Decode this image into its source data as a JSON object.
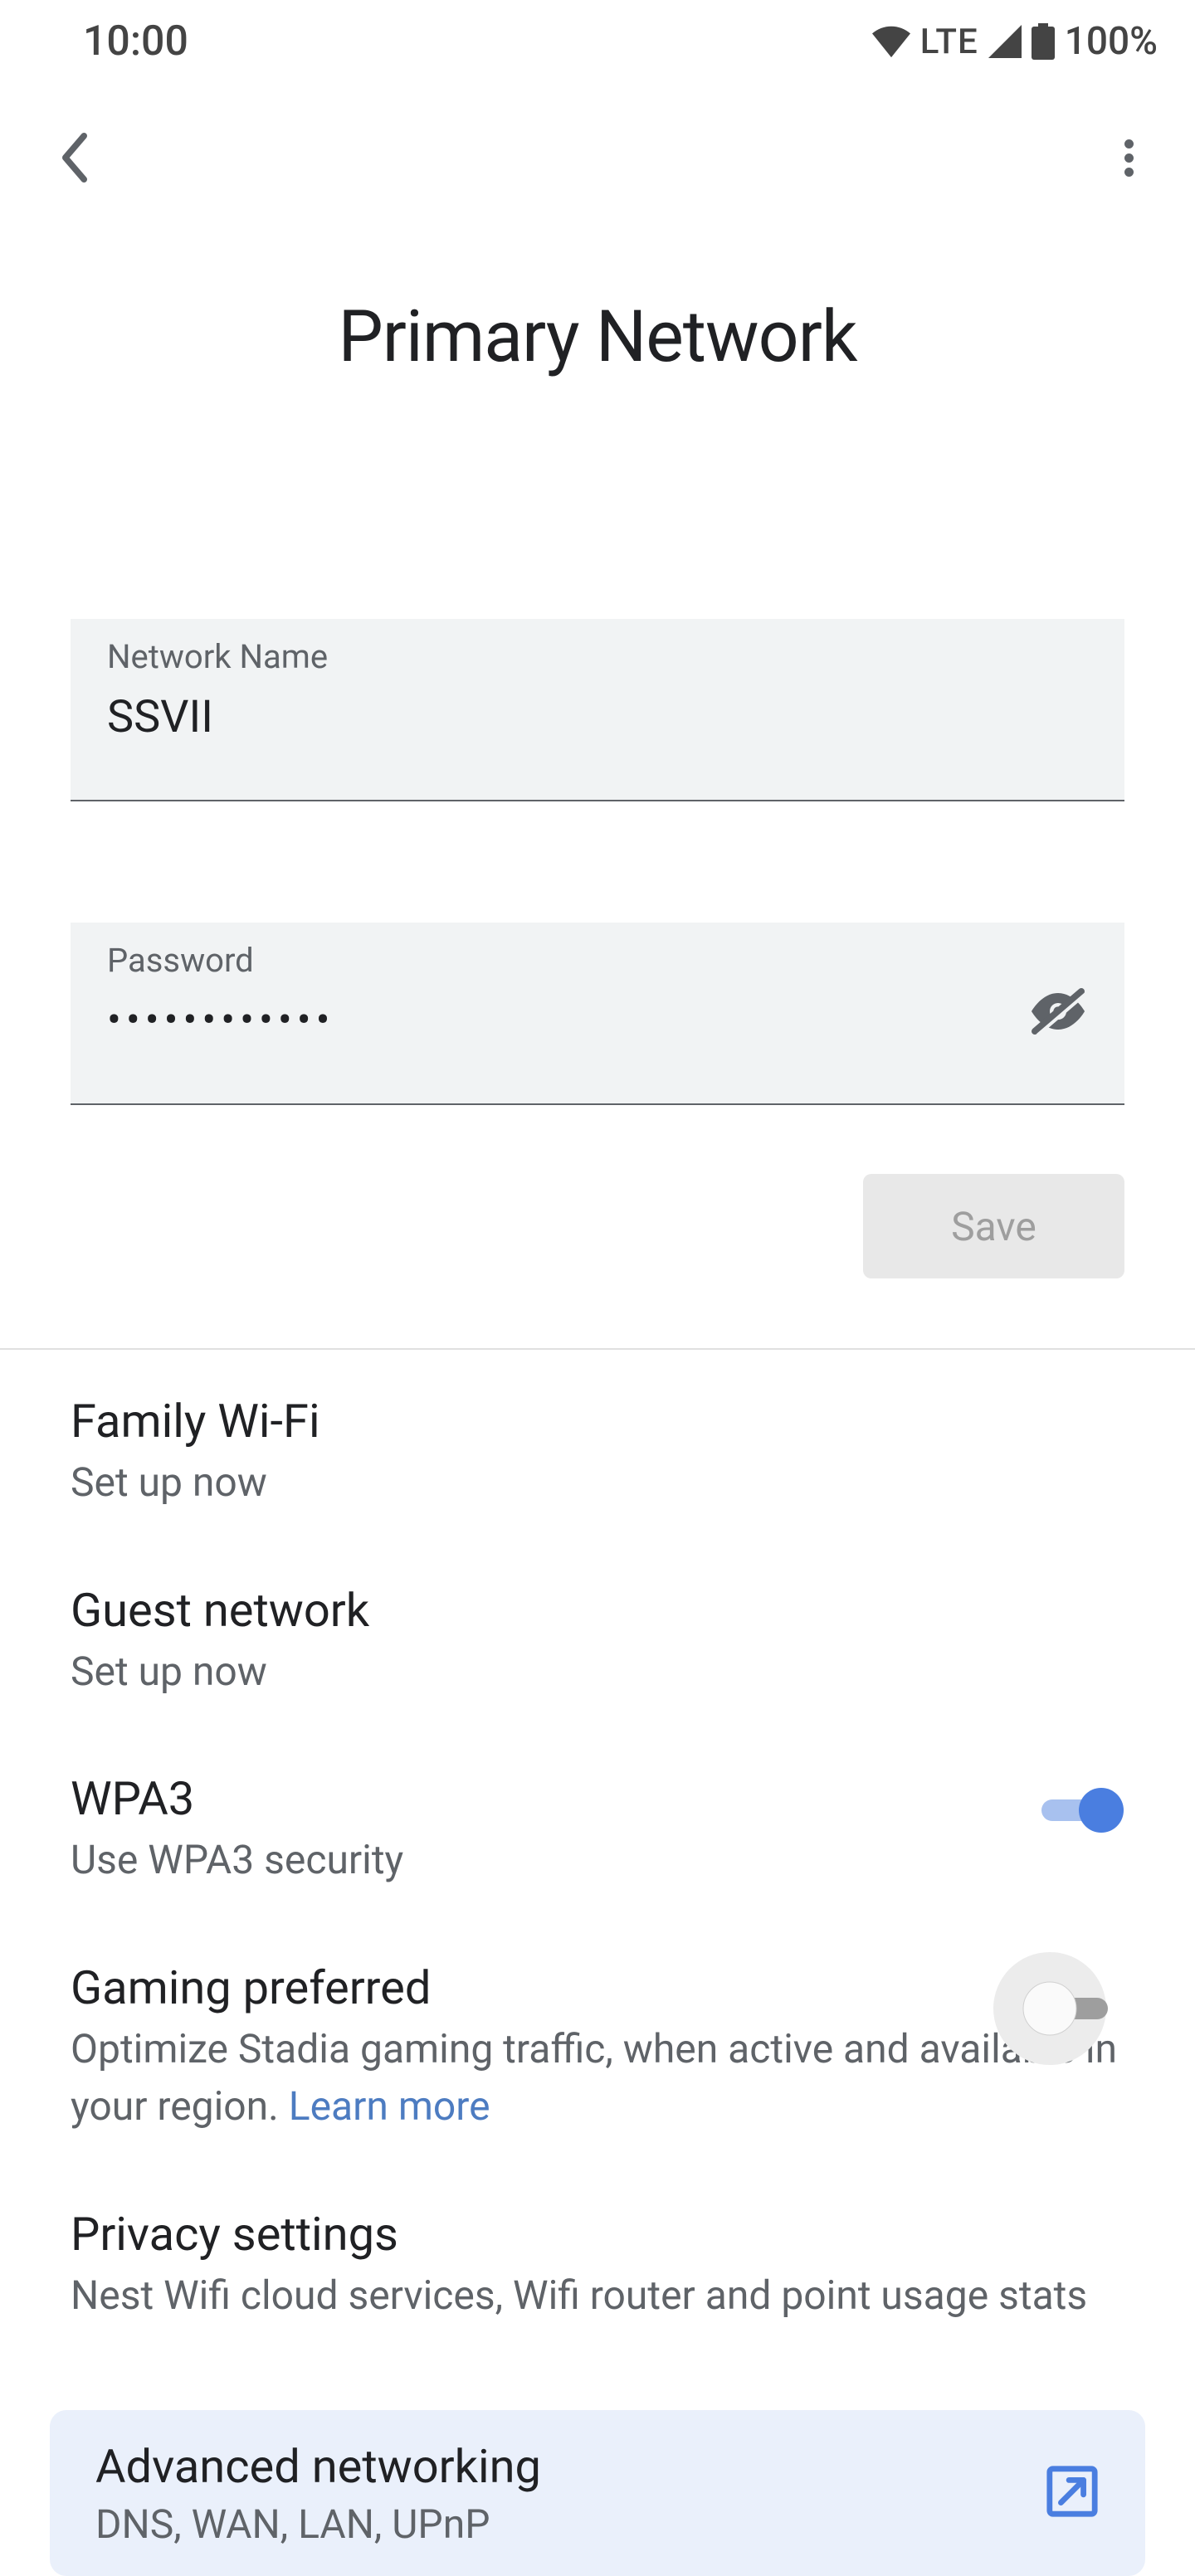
{
  "status": {
    "time": "10:00",
    "lte": "LTE",
    "battery": "100%"
  },
  "title": "Primary Network",
  "network_field": {
    "label": "Network Name",
    "value": "SSVII"
  },
  "password_field": {
    "label": "Password",
    "value": "••••••••••••"
  },
  "save_label": "Save",
  "items": {
    "family": {
      "title": "Family Wi-Fi",
      "sub": "Set up now"
    },
    "guest": {
      "title": "Guest network",
      "sub": "Set up now"
    },
    "wpa3": {
      "title": "WPA3",
      "sub": "Use WPA3 security",
      "on": true
    },
    "gaming": {
      "title": "Gaming preferred",
      "sub_pre": "Optimize Stadia gaming traffic, when active and available in your region. ",
      "learn_more": "Learn more",
      "on": false
    },
    "privacy": {
      "title": "Privacy settings",
      "sub": "Nest Wifi cloud services, Wifi router and point usage stats"
    }
  },
  "advanced": {
    "title": "Advanced networking",
    "sub": "DNS, WAN, LAN, UPnP"
  }
}
